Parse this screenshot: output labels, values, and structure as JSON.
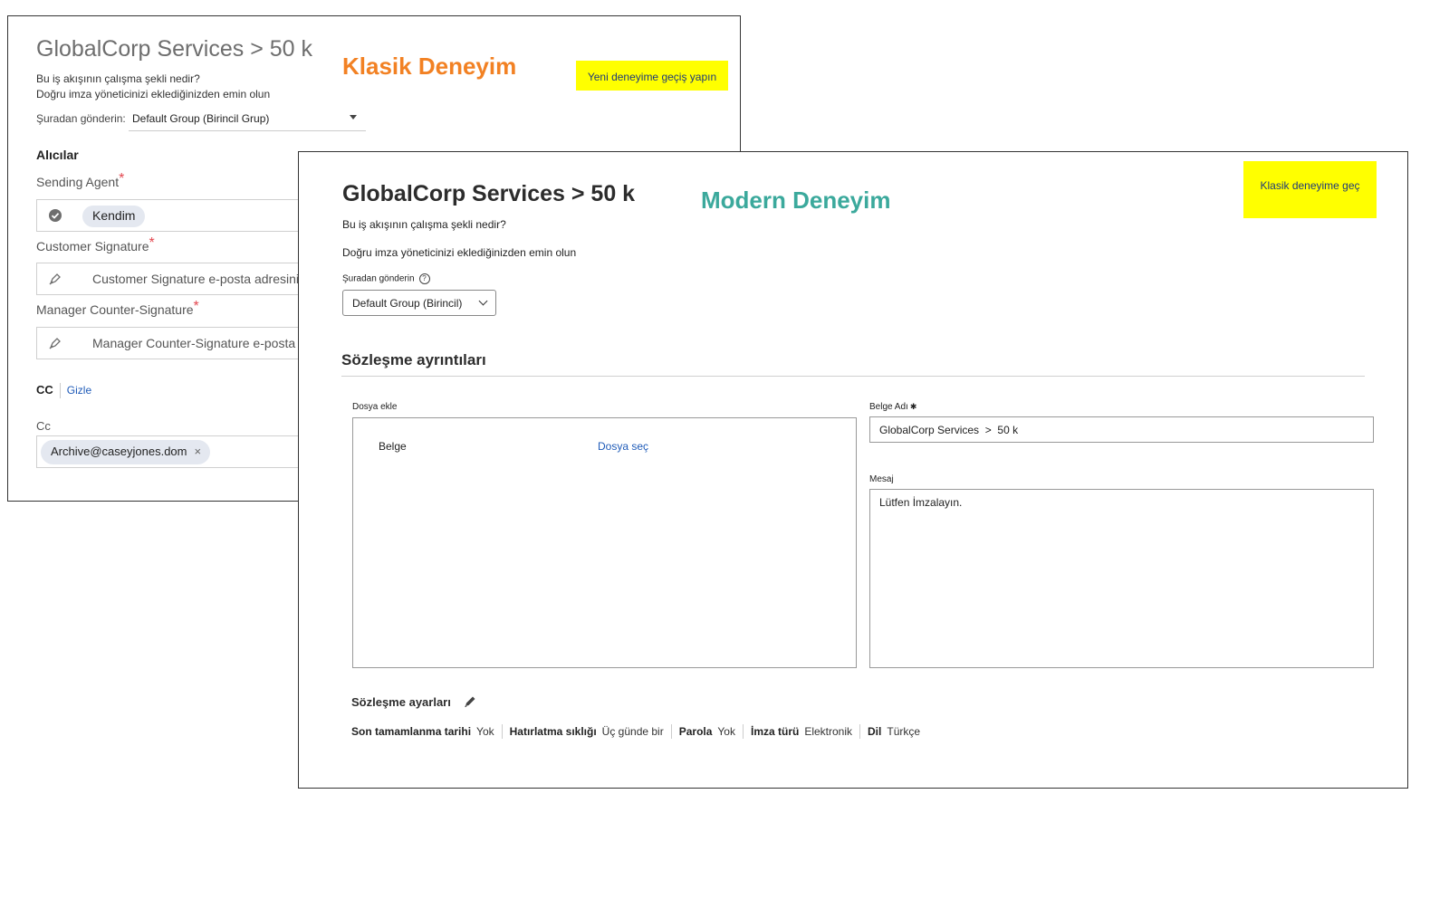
{
  "classic": {
    "title": "GlobalCorp Services > 50 k",
    "subtitle_line1": "Bu iş akışının çalışma şekli nedir?",
    "subtitle_line2": "Doğru imza yöneticinizi eklediğinizden emin olun",
    "send_from_label": "Şuradan gönderin:",
    "send_from_value": "Default Group (Birincil Grup)",
    "badge": "Klasik Deneyim",
    "switch_button": "Yeni deneyime geçiş yapın",
    "recipients_heading": "Alıcılar",
    "recipients": [
      {
        "label": "Sending Agent",
        "required_mark": "*",
        "value": "Kendim",
        "icon": "check-circle-icon"
      },
      {
        "label": "Customer Signature",
        "required_mark": "*",
        "placeholder": "Customer Signature e-posta adresini gi",
        "icon": "pen-icon"
      },
      {
        "label": "Manager Counter-Signature",
        "required_mark": "*",
        "placeholder": "Manager Counter-Signature e-posta ad",
        "icon": "pen-icon"
      }
    ],
    "cc_heading": "CC",
    "cc_hide_link": "Gizle",
    "cc_label": "Cc",
    "cc_value": "Archive@caseyjones.dom",
    "cc_remove": "×"
  },
  "modern": {
    "title": "GlobalCorp Services > 50 k",
    "badge": "Modern Deneyim",
    "switch_button": "Klasik deneyime geç",
    "subtitle_line1": "Bu iş akışının çalışma şekli nedir?",
    "subtitle_line2": "Doğru imza yöneticinizi eklediğinizden emin olun",
    "send_from_label": "Şuradan gönderin",
    "help_glyph": "?",
    "send_from_value": "Default Group (Birincil)",
    "section_title": "Sözleşme ayrıntıları",
    "file_label": "Dosya ekle",
    "file_doc": "Belge",
    "file_choose": "Dosya seç",
    "doc_name_label": "Belge Adı",
    "doc_name_star": "✱",
    "doc_name_value": "GlobalCorp Services  >  50 k",
    "message_label": "Mesaj",
    "message_value": "Lütfen İmzalayın.",
    "settings_title": "Sözleşme ayarları",
    "settings": [
      {
        "key": "Son tamamlanma tarihi",
        "value": "Yok"
      },
      {
        "key": "Hatırlatma sıklığı",
        "value": "Üç günde bir"
      },
      {
        "key": "Parola",
        "value": "Yok"
      },
      {
        "key": "İmza türü",
        "value": "Elektronik"
      },
      {
        "key": "Dil",
        "value": "Türkçe"
      }
    ]
  },
  "colors": {
    "classic_badge": "#f28123",
    "modern_badge": "#3ba99c",
    "highlight": "#ffff00",
    "link": "#1f5bb8",
    "required": "#e34850"
  }
}
